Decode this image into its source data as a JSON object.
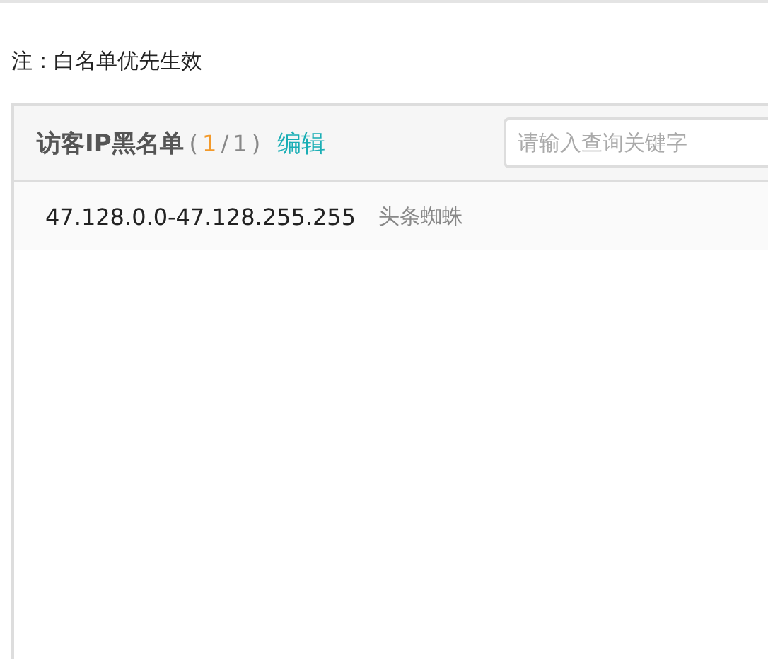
{
  "note": "注：白名单优先生效",
  "panel": {
    "title": "访客IP黑名单",
    "count": [
      {
        "kind": "punct",
        "text": "("
      },
      {
        "kind": "current",
        "text": "1"
      },
      {
        "kind": "punct",
        "text": "/"
      },
      {
        "kind": "total",
        "text": "1"
      },
      {
        "kind": "punct",
        "text": ")"
      }
    ],
    "edit_link": "编辑",
    "search": {
      "placeholder": "请输入查询关键字"
    },
    "rows": [
      {
        "ip_range": "47.128.0.0-47.128.255.255",
        "label": "头条蜘蛛"
      }
    ]
  }
}
